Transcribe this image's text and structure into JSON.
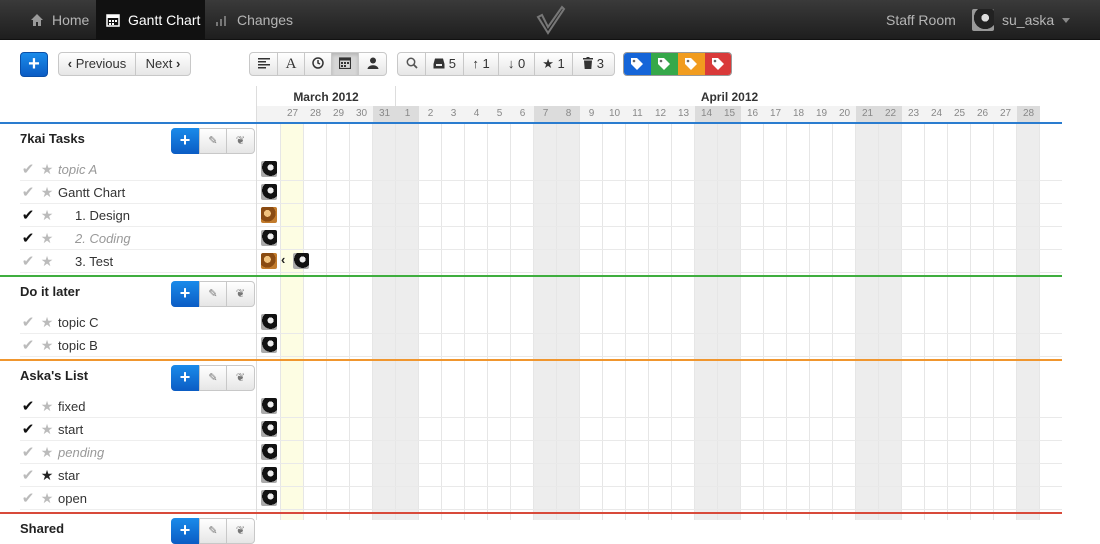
{
  "nav": {
    "home_label": "Home",
    "gantt_label": "Gantt Chart",
    "changes_label": "Changes",
    "staff_room_label": "Staff Room",
    "username": "su_aska"
  },
  "toolbar": {
    "add_label": "+",
    "previous_label": "Previous",
    "next_label": "Next",
    "view_text_label": "A",
    "inbox_count": "5",
    "up_count": "1",
    "down_count": "0",
    "star_count": "1",
    "trash_count": "3",
    "tag_colors": [
      "#1565d8",
      "#36a84a",
      "#f19c1f",
      "#d93a3a"
    ]
  },
  "timeline": {
    "months": [
      {
        "label": "March 2012"
      },
      {
        "label": "April 2012"
      }
    ],
    "days": [
      "27",
      "28",
      "29",
      "30",
      "31",
      "1",
      "2",
      "3",
      "4",
      "5",
      "6",
      "7",
      "8",
      "9",
      "10",
      "11",
      "12",
      "13",
      "14",
      "15",
      "16",
      "17",
      "18",
      "19",
      "20",
      "21",
      "22",
      "23",
      "24",
      "25",
      "26",
      "27",
      "28"
    ],
    "weekend_indexes": [
      4,
      5,
      11,
      12,
      18,
      19,
      25,
      26,
      32
    ],
    "today_index": 1
  },
  "sections": [
    {
      "title": "7kai Tasks",
      "color": "#2a7ccf",
      "tasks": [
        {
          "label": "topic A",
          "done": false,
          "star": false,
          "muted": true,
          "indent": 0,
          "avatar": "dark"
        },
        {
          "label": "Gantt Chart",
          "done": false,
          "star": false,
          "muted": false,
          "indent": 0,
          "avatar": "dark"
        },
        {
          "label": "1. Design",
          "done": true,
          "star": false,
          "muted": false,
          "indent": 1,
          "avatar": "brown"
        },
        {
          "label": "2. Coding",
          "done": true,
          "star": false,
          "muted": true,
          "indent": 1,
          "avatar": "dark"
        },
        {
          "label": "3. Test",
          "done": false,
          "star": false,
          "muted": false,
          "indent": 1,
          "avatar": "brown",
          "linked_avatar": "dark"
        }
      ]
    },
    {
      "title": "Do it later",
      "color": "#3fae3f",
      "tasks": [
        {
          "label": "topic C",
          "done": false,
          "star": false,
          "muted": false,
          "indent": 0,
          "avatar": "dark"
        },
        {
          "label": "topic B",
          "done": false,
          "star": false,
          "muted": false,
          "indent": 0,
          "avatar": "dark"
        }
      ]
    },
    {
      "title": "Aska's List",
      "color": "#f0962e",
      "tasks": [
        {
          "label": "fixed",
          "done": true,
          "star": false,
          "muted": false,
          "indent": 0,
          "avatar": "dark"
        },
        {
          "label": "start",
          "done": true,
          "star": false,
          "muted": false,
          "indent": 0,
          "avatar": "dark"
        },
        {
          "label": "pending",
          "done": false,
          "star": false,
          "muted": true,
          "indent": 0,
          "avatar": "dark"
        },
        {
          "label": "star",
          "done": false,
          "star": true,
          "muted": false,
          "indent": 0,
          "avatar": "dark"
        },
        {
          "label": "open",
          "done": false,
          "star": false,
          "muted": false,
          "indent": 0,
          "avatar": "dark"
        }
      ]
    },
    {
      "title": "Shared",
      "color": "#d84a3a",
      "tasks": []
    }
  ]
}
